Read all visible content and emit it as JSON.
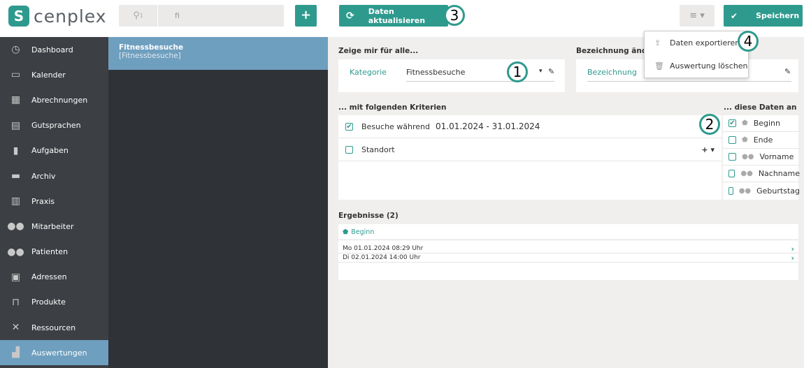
{
  "brand": {
    "name": "cenplex"
  },
  "search": {
    "filter_count": "1",
    "value": "fi"
  },
  "toolbar": {
    "add_label": "+",
    "refresh_label": "Daten aktualisieren",
    "menu_label": "≡ ▾",
    "save_label": "Speichern"
  },
  "dropdown": {
    "items": [
      {
        "label": "Daten exportieren",
        "icon": "export-icon"
      },
      {
        "label": "Auswertung löschen",
        "icon": "trash-icon"
      }
    ]
  },
  "sidebar": {
    "items": [
      {
        "label": "Dashboard",
        "icon": "dashboard-icon"
      },
      {
        "label": "Kalender",
        "icon": "calendar-icon"
      },
      {
        "label": "Abrechnungen",
        "icon": "calculator-icon"
      },
      {
        "label": "Gutsprachen",
        "icon": "document-icon"
      },
      {
        "label": "Aufgaben",
        "icon": "clipboard-icon"
      },
      {
        "label": "Archiv",
        "icon": "archive-icon"
      },
      {
        "label": "Praxis",
        "icon": "building-icon"
      },
      {
        "label": "Mitarbeiter",
        "icon": "staff-icon"
      },
      {
        "label": "Patienten",
        "icon": "patients-icon"
      },
      {
        "label": "Adressen",
        "icon": "address-icon"
      },
      {
        "label": "Produkte",
        "icon": "store-icon"
      },
      {
        "label": "Ressourcen",
        "icon": "tools-icon"
      },
      {
        "label": "Auswertungen",
        "icon": "chart-icon",
        "active": true
      }
    ]
  },
  "list": {
    "items": [
      {
        "title": "Fitnessbesuche",
        "subtitle": "[Fitnessbesuche]"
      }
    ]
  },
  "show_section": {
    "title": "Zeige mir für alle...",
    "field_label": "Kategorie",
    "field_value": "Fitnessbesuche"
  },
  "name_section": {
    "title": "Bezeichnung ändern",
    "field_label": "Bezeichnung"
  },
  "criteria_section": {
    "title": "... mit folgenden Kriterien",
    "rows": [
      {
        "label": "Besuche während",
        "value": "01.01.2024 - 31.01.2024",
        "checked": true
      },
      {
        "label": "Standort",
        "value": "",
        "checked": false
      }
    ]
  },
  "data_section": {
    "title": "... diese Daten an",
    "items": [
      {
        "label": "Beginn",
        "checked": true
      },
      {
        "label": "Ende",
        "checked": false
      },
      {
        "label": "Vorname",
        "checked": false
      },
      {
        "label": "Nachname",
        "checked": false
      },
      {
        "label": "Geburtstag",
        "checked": false
      }
    ]
  },
  "results": {
    "title": "Ergebnisse (2)",
    "column": "Beginn",
    "rows": [
      "Mo 01.01.2024 08:29 Uhr",
      "Di 02.01.2024 14:00 Uhr"
    ]
  },
  "callouts": [
    "1",
    "2",
    "3",
    "4"
  ],
  "colors": {
    "accent": "#2e9a8e",
    "sidebar": "#3c3f44",
    "active": "#6f9fbf"
  }
}
